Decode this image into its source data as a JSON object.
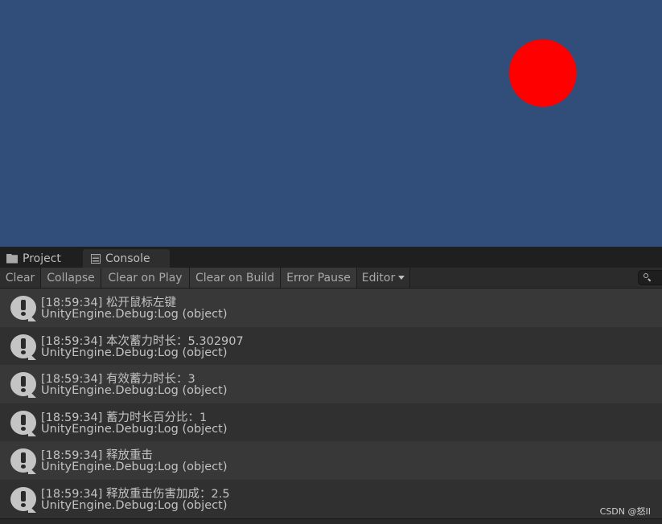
{
  "game_view": {
    "background": "#314d79",
    "circle_color": "#ff0000"
  },
  "tabs": [
    {
      "label": "Project",
      "icon": "folder-icon",
      "active": false
    },
    {
      "label": "Console",
      "icon": "console-icon",
      "active": true
    }
  ],
  "toolbar": {
    "buttons": [
      {
        "label": "Clear",
        "toggled": false
      },
      {
        "label": "Collapse",
        "toggled": true
      },
      {
        "label": "Clear on Play",
        "toggled": true
      },
      {
        "label": "Clear on Build",
        "toggled": true
      },
      {
        "label": "Error Pause",
        "toggled": true
      },
      {
        "label": "Editor",
        "dropdown": true
      }
    ],
    "search_placeholder": ""
  },
  "log_entries": [
    {
      "message": "[18:59:34] 松开鼠标左键",
      "source": "UnityEngine.Debug:Log (object)",
      "icon": "info-icon"
    },
    {
      "message": "[18:59:34] 本次蓄力时长：5.302907",
      "source": "UnityEngine.Debug:Log (object)",
      "icon": "info-icon"
    },
    {
      "message": "[18:59:34] 有效蓄力时长：3",
      "source": "UnityEngine.Debug:Log (object)",
      "icon": "info-icon"
    },
    {
      "message": "[18:59:34] 蓄力时长百分比：1",
      "source": "UnityEngine.Debug:Log (object)",
      "icon": "info-icon"
    },
    {
      "message": "[18:59:34] 释放重击",
      "source": "UnityEngine.Debug:Log (object)",
      "icon": "info-icon"
    },
    {
      "message": "[18:59:34] 释放重击伤害加成：2.5",
      "source": "UnityEngine.Debug:Log (object)",
      "icon": "info-icon"
    }
  ],
  "watermark": "CSDN @怒II"
}
